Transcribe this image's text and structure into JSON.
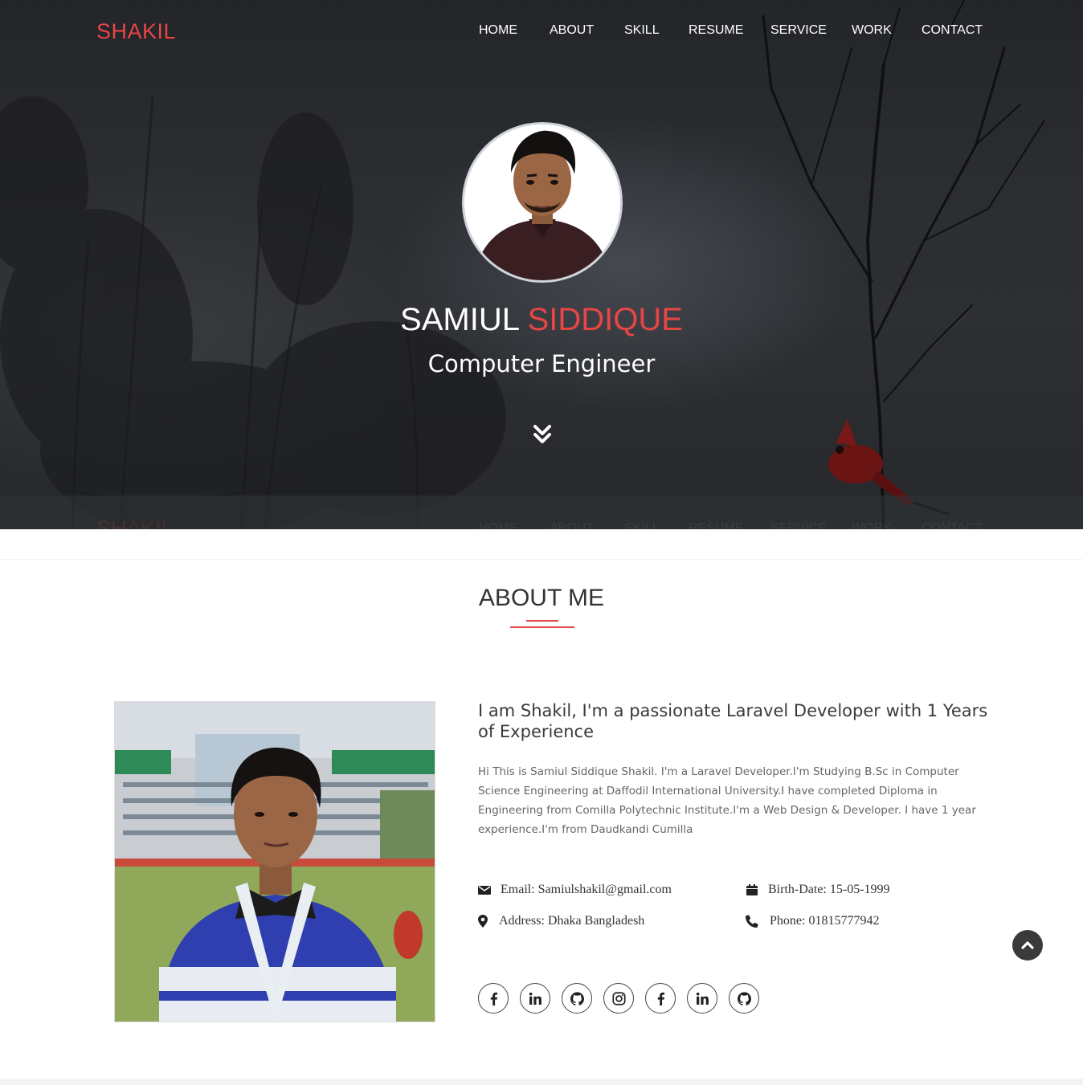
{
  "brand": {
    "logo": "SHAKIL",
    "accent_color": "#e84545"
  },
  "nav": {
    "items": [
      {
        "label": "HOME"
      },
      {
        "label": "ABOUT"
      },
      {
        "label": "SKILL"
      },
      {
        "label": "RESUME"
      },
      {
        "label": "SERVICE"
      },
      {
        "label": "WORK"
      },
      {
        "label": "CONTACT"
      }
    ]
  },
  "hero": {
    "first_name": "SAMIUL",
    "last_name": "SIDDIQUE",
    "role": "Computer Engineer",
    "scroll_icon": "double-chevron-down-icon"
  },
  "about": {
    "title": "ABOUT ME",
    "heading": "I am Shakil, I'm a passionate Laravel Developer with 1 Years of Experience",
    "description": "Hi This is Samiul Siddique Shakil. I'm a Laravel Developer.I'm Studying B.Sc in Computer Science Engineering at Daffodil International University.I have completed Diploma in Engineering from Comilla Polytechnic Institute.I'm a Web Design & Developer. I have 1 year experience.I'm from Daudkandi Cumilla",
    "info": {
      "email": "Email: Samiulshakil@gmail.com",
      "birth_date": "Birth-Date: 15-05-1999",
      "address": "Address: Dhaka Bangladesh",
      "phone": "Phone: 01815777942"
    },
    "social": [
      {
        "icon": "facebook-icon"
      },
      {
        "icon": "linkedin-icon"
      },
      {
        "icon": "github-icon"
      },
      {
        "icon": "instagram-icon"
      },
      {
        "icon": "facebook-icon"
      },
      {
        "icon": "linkedin-icon"
      },
      {
        "icon": "github-icon"
      }
    ]
  },
  "back_to_top_icon": "chevron-up-icon"
}
